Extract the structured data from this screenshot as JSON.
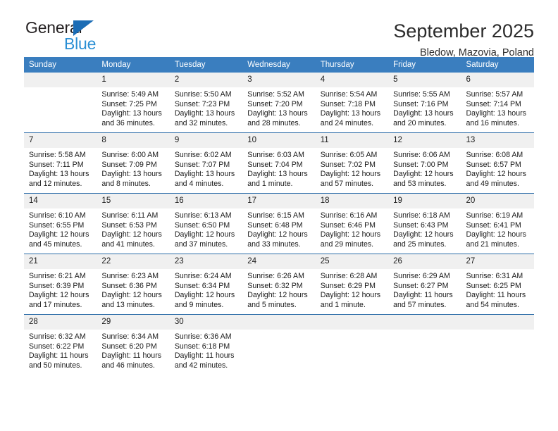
{
  "brand": {
    "name_top": "General",
    "name_bottom": "Blue",
    "triangle_color": "#1b6cb5",
    "bottom_color": "#2a8fd4"
  },
  "header": {
    "title": "September 2025",
    "subtitle": "Bledow, Mazovia, Poland"
  },
  "theme": {
    "header_bg": "#3a7ebf",
    "row_divider": "#2b6ca8",
    "daynum_bg": "#f0f0f0",
    "text": "#1a1a1a"
  },
  "columns": [
    "Sunday",
    "Monday",
    "Tuesday",
    "Wednesday",
    "Thursday",
    "Friday",
    "Saturday"
  ],
  "weeks": [
    [
      {
        "day": "",
        "sunrise": "",
        "sunset": "",
        "daylight1": "",
        "daylight2": "",
        "empty": true
      },
      {
        "day": "1",
        "sunrise": "Sunrise: 5:49 AM",
        "sunset": "Sunset: 7:25 PM",
        "daylight1": "Daylight: 13 hours",
        "daylight2": "and 36 minutes."
      },
      {
        "day": "2",
        "sunrise": "Sunrise: 5:50 AM",
        "sunset": "Sunset: 7:23 PM",
        "daylight1": "Daylight: 13 hours",
        "daylight2": "and 32 minutes."
      },
      {
        "day": "3",
        "sunrise": "Sunrise: 5:52 AM",
        "sunset": "Sunset: 7:20 PM",
        "daylight1": "Daylight: 13 hours",
        "daylight2": "and 28 minutes."
      },
      {
        "day": "4",
        "sunrise": "Sunrise: 5:54 AM",
        "sunset": "Sunset: 7:18 PM",
        "daylight1": "Daylight: 13 hours",
        "daylight2": "and 24 minutes."
      },
      {
        "day": "5",
        "sunrise": "Sunrise: 5:55 AM",
        "sunset": "Sunset: 7:16 PM",
        "daylight1": "Daylight: 13 hours",
        "daylight2": "and 20 minutes."
      },
      {
        "day": "6",
        "sunrise": "Sunrise: 5:57 AM",
        "sunset": "Sunset: 7:14 PM",
        "daylight1": "Daylight: 13 hours",
        "daylight2": "and 16 minutes."
      }
    ],
    [
      {
        "day": "7",
        "sunrise": "Sunrise: 5:58 AM",
        "sunset": "Sunset: 7:11 PM",
        "daylight1": "Daylight: 13 hours",
        "daylight2": "and 12 minutes."
      },
      {
        "day": "8",
        "sunrise": "Sunrise: 6:00 AM",
        "sunset": "Sunset: 7:09 PM",
        "daylight1": "Daylight: 13 hours",
        "daylight2": "and 8 minutes."
      },
      {
        "day": "9",
        "sunrise": "Sunrise: 6:02 AM",
        "sunset": "Sunset: 7:07 PM",
        "daylight1": "Daylight: 13 hours",
        "daylight2": "and 4 minutes."
      },
      {
        "day": "10",
        "sunrise": "Sunrise: 6:03 AM",
        "sunset": "Sunset: 7:04 PM",
        "daylight1": "Daylight: 13 hours",
        "daylight2": "and 1 minute."
      },
      {
        "day": "11",
        "sunrise": "Sunrise: 6:05 AM",
        "sunset": "Sunset: 7:02 PM",
        "daylight1": "Daylight: 12 hours",
        "daylight2": "and 57 minutes."
      },
      {
        "day": "12",
        "sunrise": "Sunrise: 6:06 AM",
        "sunset": "Sunset: 7:00 PM",
        "daylight1": "Daylight: 12 hours",
        "daylight2": "and 53 minutes."
      },
      {
        "day": "13",
        "sunrise": "Sunrise: 6:08 AM",
        "sunset": "Sunset: 6:57 PM",
        "daylight1": "Daylight: 12 hours",
        "daylight2": "and 49 minutes."
      }
    ],
    [
      {
        "day": "14",
        "sunrise": "Sunrise: 6:10 AM",
        "sunset": "Sunset: 6:55 PM",
        "daylight1": "Daylight: 12 hours",
        "daylight2": "and 45 minutes."
      },
      {
        "day": "15",
        "sunrise": "Sunrise: 6:11 AM",
        "sunset": "Sunset: 6:53 PM",
        "daylight1": "Daylight: 12 hours",
        "daylight2": "and 41 minutes."
      },
      {
        "day": "16",
        "sunrise": "Sunrise: 6:13 AM",
        "sunset": "Sunset: 6:50 PM",
        "daylight1": "Daylight: 12 hours",
        "daylight2": "and 37 minutes."
      },
      {
        "day": "17",
        "sunrise": "Sunrise: 6:15 AM",
        "sunset": "Sunset: 6:48 PM",
        "daylight1": "Daylight: 12 hours",
        "daylight2": "and 33 minutes."
      },
      {
        "day": "18",
        "sunrise": "Sunrise: 6:16 AM",
        "sunset": "Sunset: 6:46 PM",
        "daylight1": "Daylight: 12 hours",
        "daylight2": "and 29 minutes."
      },
      {
        "day": "19",
        "sunrise": "Sunrise: 6:18 AM",
        "sunset": "Sunset: 6:43 PM",
        "daylight1": "Daylight: 12 hours",
        "daylight2": "and 25 minutes."
      },
      {
        "day": "20",
        "sunrise": "Sunrise: 6:19 AM",
        "sunset": "Sunset: 6:41 PM",
        "daylight1": "Daylight: 12 hours",
        "daylight2": "and 21 minutes."
      }
    ],
    [
      {
        "day": "21",
        "sunrise": "Sunrise: 6:21 AM",
        "sunset": "Sunset: 6:39 PM",
        "daylight1": "Daylight: 12 hours",
        "daylight2": "and 17 minutes."
      },
      {
        "day": "22",
        "sunrise": "Sunrise: 6:23 AM",
        "sunset": "Sunset: 6:36 PM",
        "daylight1": "Daylight: 12 hours",
        "daylight2": "and 13 minutes."
      },
      {
        "day": "23",
        "sunrise": "Sunrise: 6:24 AM",
        "sunset": "Sunset: 6:34 PM",
        "daylight1": "Daylight: 12 hours",
        "daylight2": "and 9 minutes."
      },
      {
        "day": "24",
        "sunrise": "Sunrise: 6:26 AM",
        "sunset": "Sunset: 6:32 PM",
        "daylight1": "Daylight: 12 hours",
        "daylight2": "and 5 minutes."
      },
      {
        "day": "25",
        "sunrise": "Sunrise: 6:28 AM",
        "sunset": "Sunset: 6:29 PM",
        "daylight1": "Daylight: 12 hours",
        "daylight2": "and 1 minute."
      },
      {
        "day": "26",
        "sunrise": "Sunrise: 6:29 AM",
        "sunset": "Sunset: 6:27 PM",
        "daylight1": "Daylight: 11 hours",
        "daylight2": "and 57 minutes."
      },
      {
        "day": "27",
        "sunrise": "Sunrise: 6:31 AM",
        "sunset": "Sunset: 6:25 PM",
        "daylight1": "Daylight: 11 hours",
        "daylight2": "and 54 minutes."
      }
    ],
    [
      {
        "day": "28",
        "sunrise": "Sunrise: 6:32 AM",
        "sunset": "Sunset: 6:22 PM",
        "daylight1": "Daylight: 11 hours",
        "daylight2": "and 50 minutes."
      },
      {
        "day": "29",
        "sunrise": "Sunrise: 6:34 AM",
        "sunset": "Sunset: 6:20 PM",
        "daylight1": "Daylight: 11 hours",
        "daylight2": "and 46 minutes."
      },
      {
        "day": "30",
        "sunrise": "Sunrise: 6:36 AM",
        "sunset": "Sunset: 6:18 PM",
        "daylight1": "Daylight: 11 hours",
        "daylight2": "and 42 minutes."
      },
      {
        "day": "",
        "sunrise": "",
        "sunset": "",
        "daylight1": "",
        "daylight2": "",
        "empty": true
      },
      {
        "day": "",
        "sunrise": "",
        "sunset": "",
        "daylight1": "",
        "daylight2": "",
        "empty": true
      },
      {
        "day": "",
        "sunrise": "",
        "sunset": "",
        "daylight1": "",
        "daylight2": "",
        "empty": true
      },
      {
        "day": "",
        "sunrise": "",
        "sunset": "",
        "daylight1": "",
        "daylight2": "",
        "empty": true
      }
    ]
  ]
}
